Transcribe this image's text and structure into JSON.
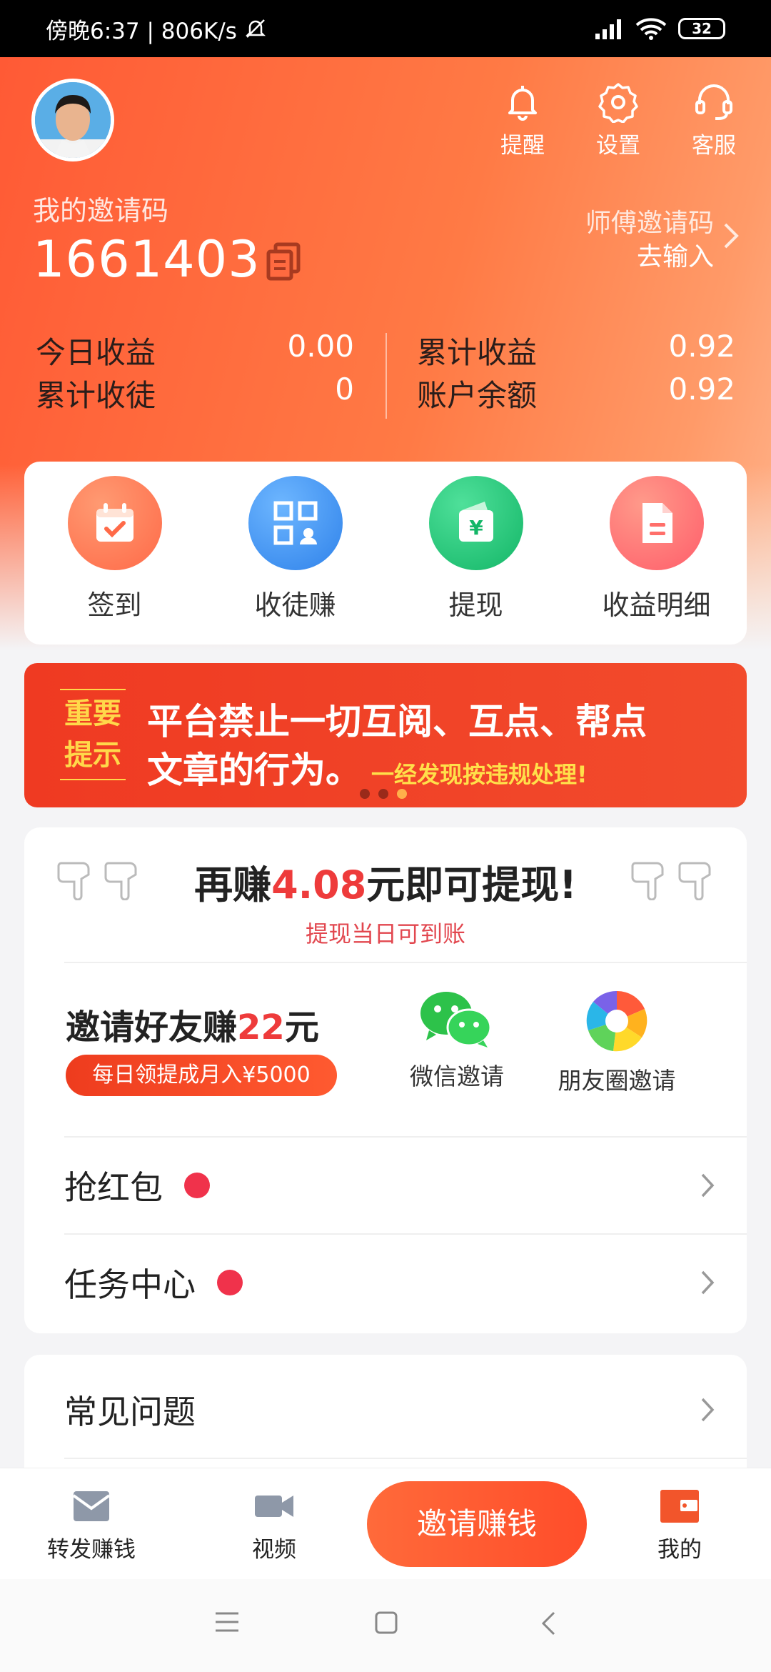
{
  "status_bar": {
    "time_text": "傍晚6:37 | 806K/s",
    "battery": "32"
  },
  "header": {
    "actions": [
      {
        "label": "提醒",
        "icon": "bell-icon"
      },
      {
        "label": "设置",
        "icon": "gear-icon"
      },
      {
        "label": "客服",
        "icon": "headset-icon"
      }
    ],
    "invite_label": "我的邀请码",
    "invite_code": "1661403",
    "master_label": "师傅邀请码",
    "master_action": "去输入",
    "stats": {
      "today_label": "今日收益",
      "today_value": "0.00",
      "disciples_label": "累计收徒",
      "disciples_value": "0",
      "total_label": "累计收益",
      "total_value": "0.92",
      "balance_label": "账户余额",
      "balance_value": "0.92"
    }
  },
  "quick_actions": [
    {
      "label": "签到",
      "icon": "calendar-check-icon",
      "color": "#ff7a55"
    },
    {
      "label": "收徒赚",
      "icon": "qr-user-icon",
      "color": "#3d8ff2"
    },
    {
      "label": "提现",
      "icon": "wallet-yuan-icon",
      "color": "#20bf72"
    },
    {
      "label": "收益明细",
      "icon": "document-icon",
      "color": "#ff6f6a"
    }
  ],
  "banner": {
    "tag": "重要提示",
    "line1": "平台禁止一切互阅、互点、帮点",
    "line2": "文章的行为。",
    "line2_highlight": "一经发现按违规处理!"
  },
  "earn": {
    "head_prefix": "再赚",
    "head_amount": "4.08",
    "head_suffix": "元即可提现!",
    "sub": "提现当日可到账",
    "invite_title_prefix": "邀请好友赚",
    "invite_title_amount": "22",
    "invite_title_suffix": "元",
    "invite_pill": "每日领提成月入¥5000",
    "share_wechat": "微信邀请",
    "share_moments": "朋友圈邀请",
    "menu": [
      {
        "label": "抢红包"
      },
      {
        "label": "任务中心"
      }
    ]
  },
  "faq": {
    "label": "常见问题"
  },
  "bottom_nav": {
    "forward": "转发赚钱",
    "video": "视频",
    "cta": "邀请赚钱",
    "mine": "我的"
  }
}
